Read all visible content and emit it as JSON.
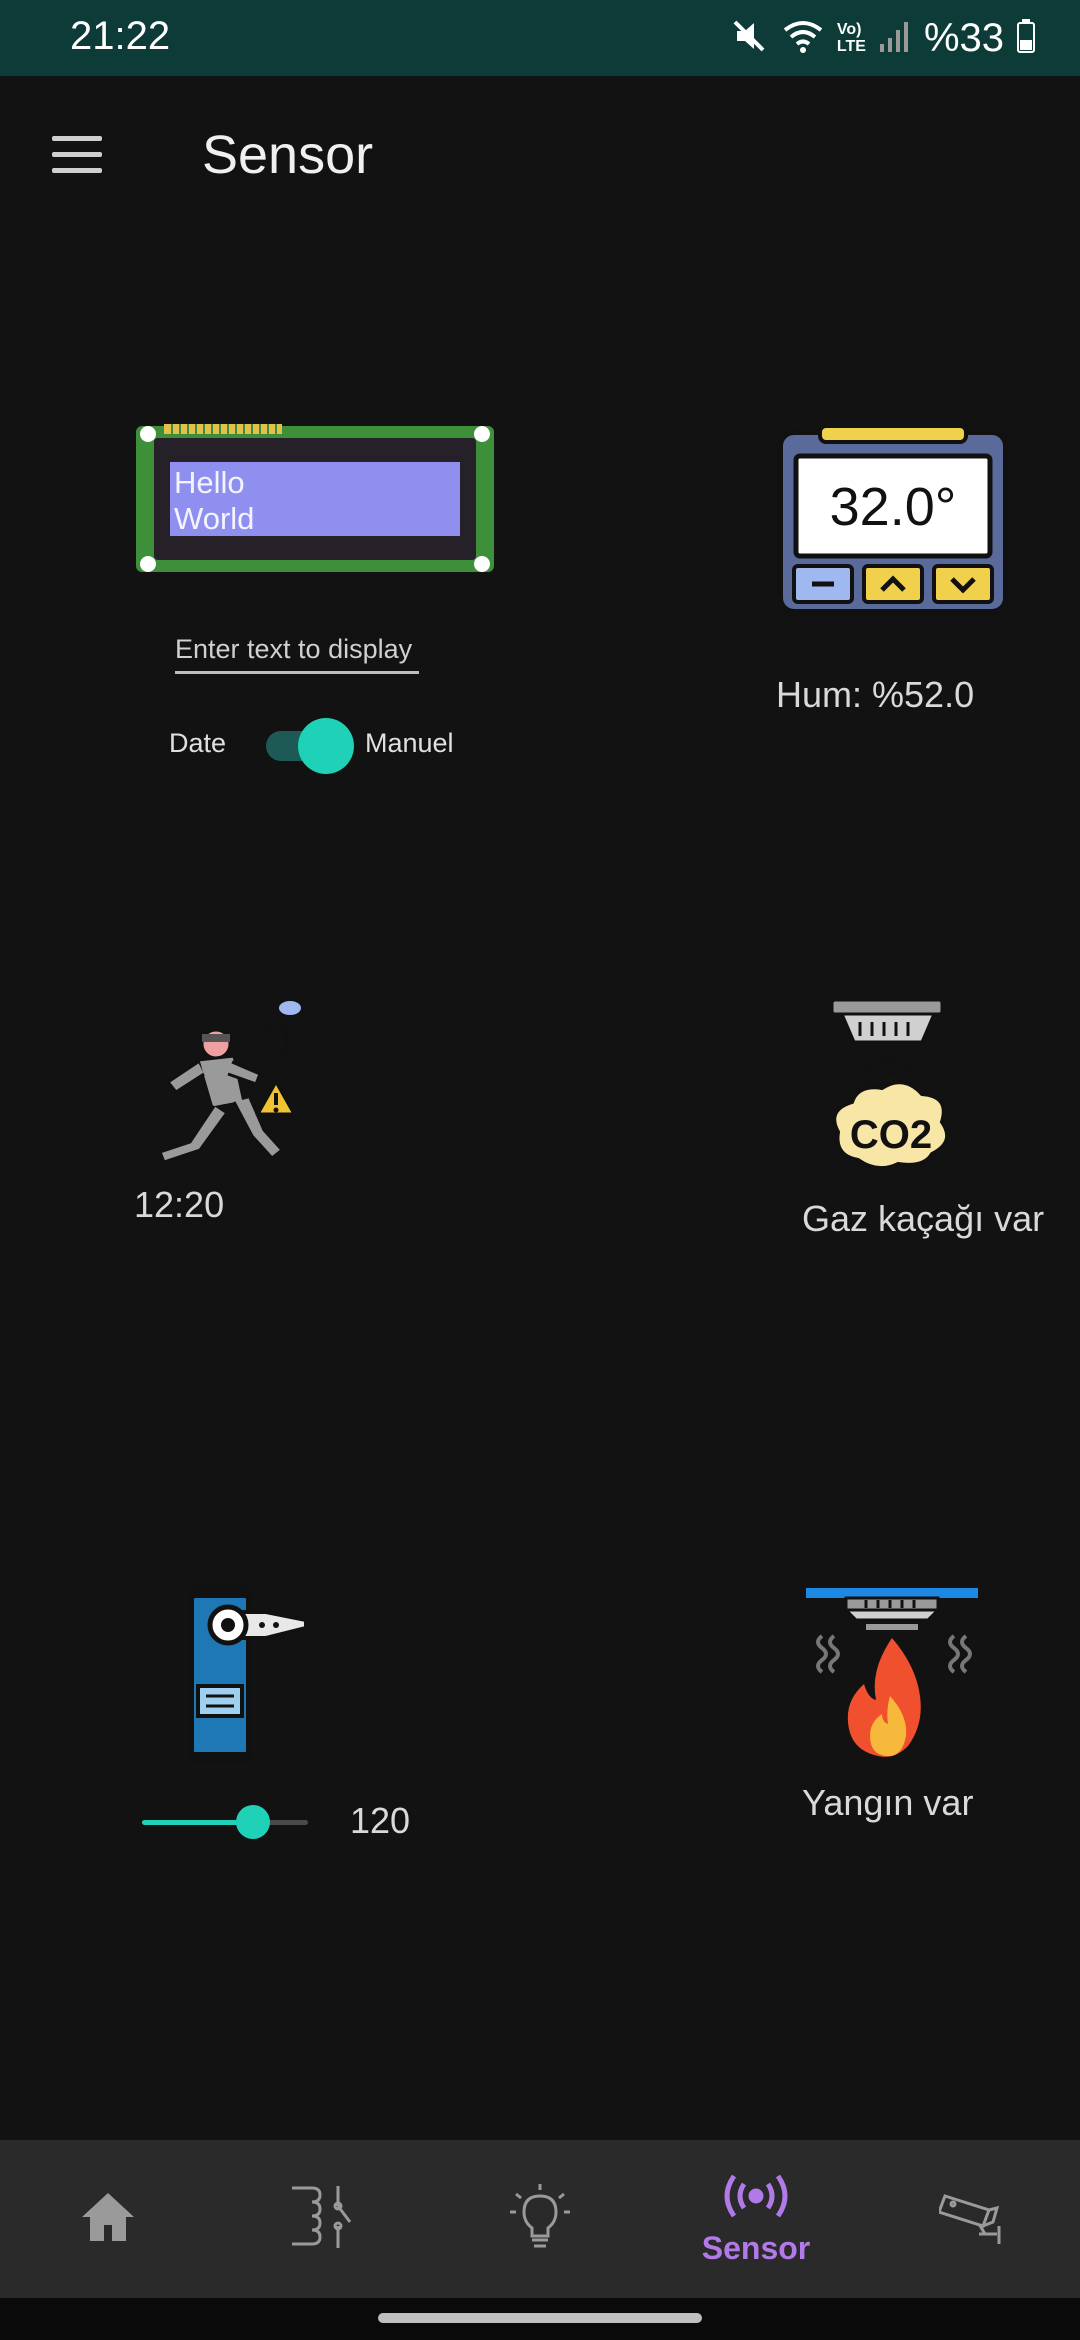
{
  "status_bar": {
    "time": "21:22",
    "network_label_top": "Vo)",
    "network_label_bottom": "LTE",
    "battery": "%33",
    "icons": [
      "mute-icon",
      "wifi-icon",
      "volte-icon",
      "signal-icon",
      "battery-icon"
    ]
  },
  "app_bar": {
    "title": "Sensor",
    "menu_icon": "hamburger-menu-icon"
  },
  "lcd": {
    "line1": "Hello",
    "line2": "World",
    "input_placeholder": "Enter text to display",
    "input_value": "",
    "switch_left_label": "Date",
    "switch_right_label": "Manuel",
    "switch_on": true
  },
  "thermostat": {
    "temperature": "32.0°",
    "humidity": "Hum: %52.0"
  },
  "motion": {
    "time": "12:20",
    "icon": "intruder-alarm-icon"
  },
  "gas": {
    "badge": "CO2",
    "status": "Gaz kaçağı var",
    "icon": "co2-detector-icon"
  },
  "servo": {
    "value": "120",
    "slider_fraction": 0.67,
    "icon": "servo-motor-icon"
  },
  "fire": {
    "status": "Yangın var",
    "icon": "smoke-detector-fire-icon"
  },
  "colors": {
    "accent": "#1fd1b6",
    "nav_active": "#b27ae8",
    "status_bar": "#0d3b38",
    "background": "#121212"
  },
  "bottom_nav": {
    "items": [
      {
        "icon": "home-icon",
        "label": ""
      },
      {
        "icon": "relay-icon",
        "label": ""
      },
      {
        "icon": "light-bulb-icon",
        "label": ""
      },
      {
        "icon": "sensor-broadcast-icon",
        "label": "Sensor"
      },
      {
        "icon": "security-camera-icon",
        "label": ""
      }
    ],
    "active_index": 3
  }
}
